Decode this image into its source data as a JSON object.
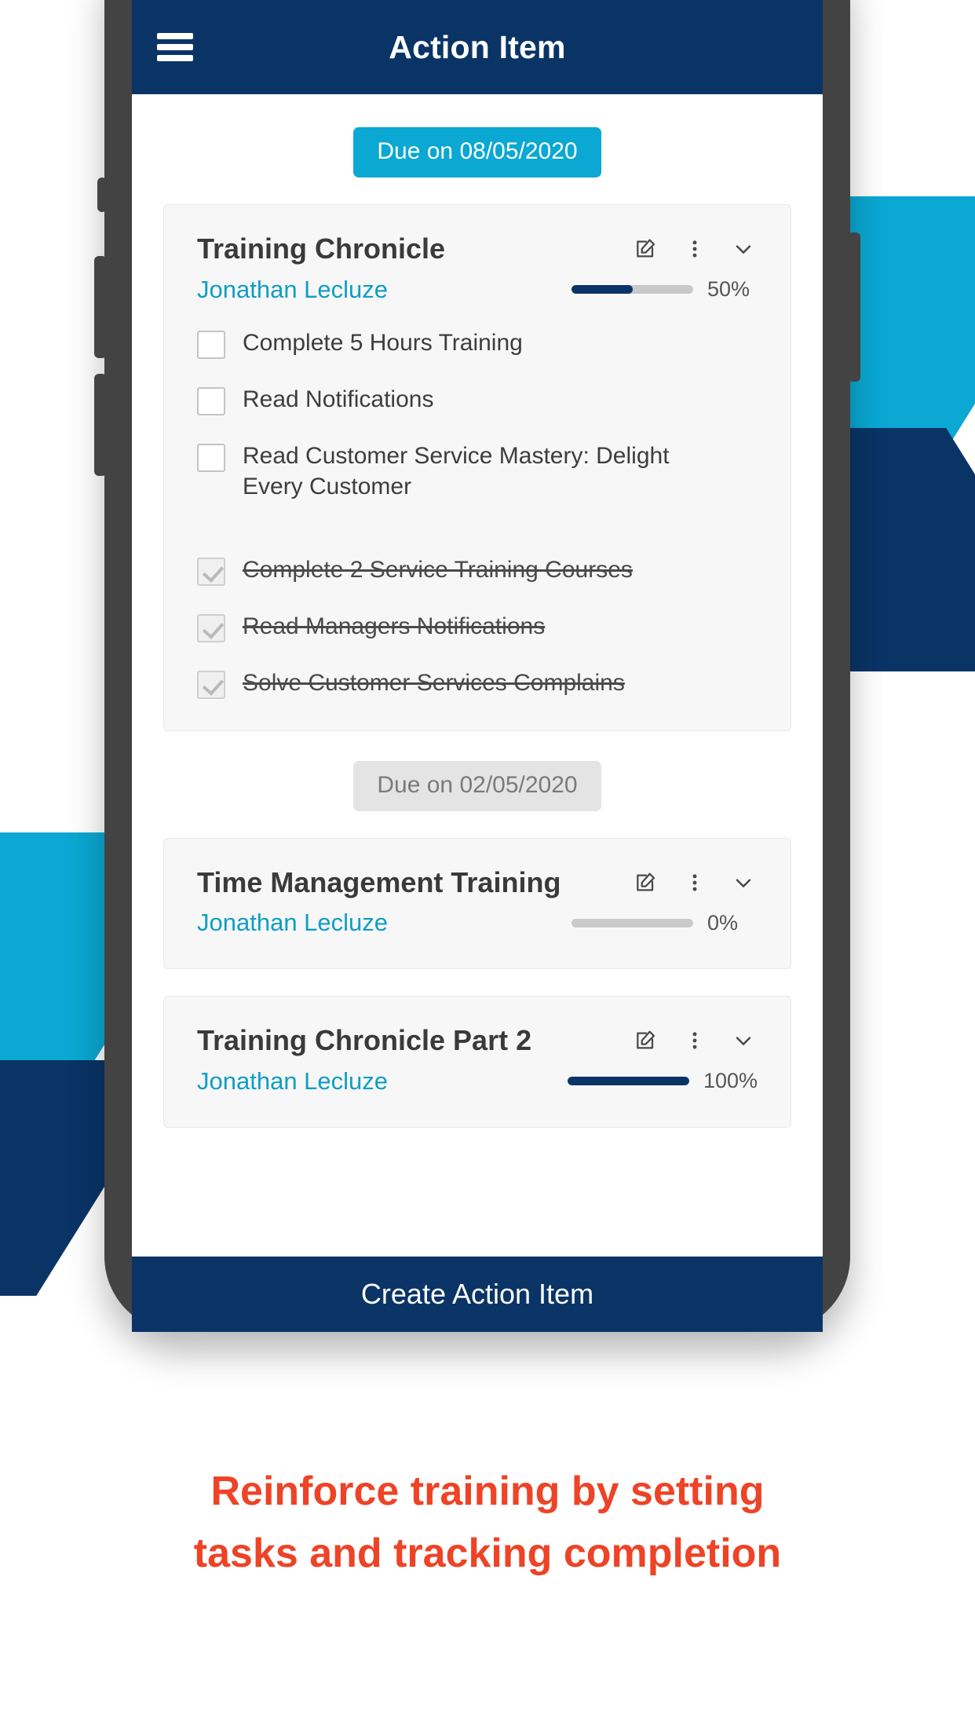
{
  "appbar": {
    "menu_icon": "hamburger-menu-icon",
    "title": "Action Item"
  },
  "groups": [
    {
      "due_badge": "Due on 08/05/2020",
      "badge_style": "accent"
    },
    {
      "due_badge": "Due on 02/05/2020",
      "badge_style": "muted"
    }
  ],
  "cards": [
    {
      "title": "Training Chronicle",
      "assignee": "Jonathan Lecluze",
      "progress": 50,
      "progress_label": "50%",
      "edit_icon": "edit-pencil-square-icon",
      "more_icon": "more-vertical-dots-icon",
      "collapse_icon": "chevron-down-icon",
      "tasks": [
        {
          "label": "Complete 5 Hours Training",
          "done": false
        },
        {
          "label": "Read Notifications",
          "done": false
        },
        {
          "label": "Read Customer Service Mastery: Delight Every Customer",
          "done": false
        },
        {
          "label": "Complete 2 Service Training Courses",
          "done": true
        },
        {
          "label": "Read Managers Notifications",
          "done": true
        },
        {
          "label": "Solve Customer Services Complains",
          "done": true
        }
      ]
    },
    {
      "title": "Time Management Training",
      "assignee": "Jonathan Lecluze",
      "progress": 0,
      "progress_label": "0%",
      "edit_icon": "edit-pencil-square-icon",
      "more_icon": "more-vertical-dots-icon",
      "collapse_icon": "chevron-down-icon",
      "tasks": []
    },
    {
      "title": "Training Chronicle Part 2",
      "assignee": "Jonathan Lecluze",
      "progress": 100,
      "progress_label": "100%",
      "edit_icon": "edit-pencil-square-icon",
      "more_icon": "more-vertical-dots-icon",
      "collapse_icon": "chevron-down-icon",
      "tasks": []
    }
  ],
  "cta": {
    "label": "Create Action Item"
  },
  "caption": {
    "line1": "Reinforce training by setting",
    "line2": "tasks and tracking completion"
  },
  "colors": {
    "navy": "#0a3466",
    "cyan": "#0aa8d2",
    "teal_text": "#0f9ec4",
    "caption_red": "#ee4326",
    "card_bg": "#f7f7f7",
    "muted_badge": "#e4e4e4",
    "frame": "#434343"
  }
}
